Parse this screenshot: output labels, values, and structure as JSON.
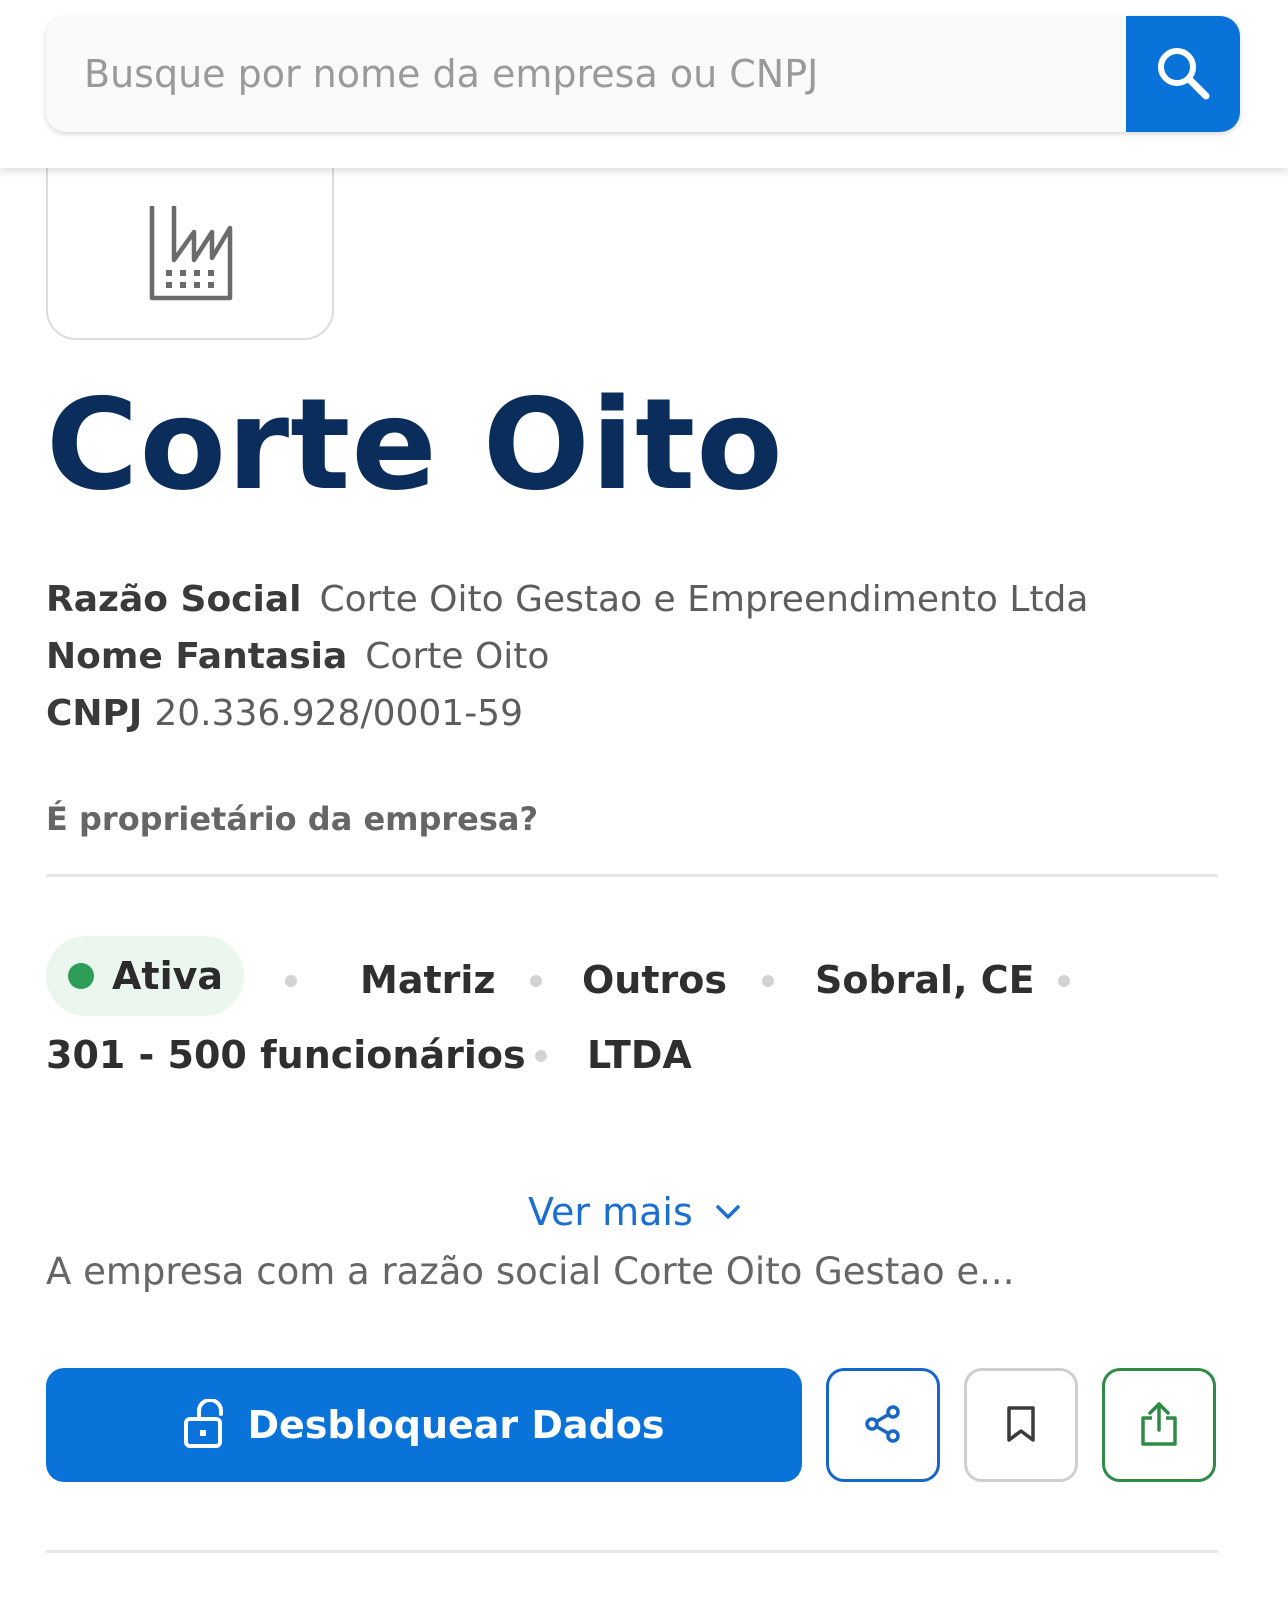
{
  "search": {
    "placeholder": "Busque por nome da empresa ou CNPJ"
  },
  "company": {
    "title": "Corte Oito",
    "razao_social_label": "Razão Social",
    "razao_social_value": "Corte Oito Gestao e Empreendimento Ltda",
    "nome_fantasia_label": "Nome Fantasia",
    "nome_fantasia_value": "Corte Oito",
    "cnpj_label": "CNPJ",
    "cnpj_value": "20.336.928/0001-59",
    "owner_question": "É proprietário da empresa?"
  },
  "tags": {
    "status": "Ativa",
    "type": "Matriz",
    "category": "Outros",
    "location": "Sobral, CE",
    "employees": "301 - 500 funcionários",
    "legal_form": "LTDA"
  },
  "details": {
    "ver_mais_label": "Ver mais",
    "description": "A empresa com a razão social Corte Oito Gestao e..."
  },
  "actions": {
    "unlock_label": "Desbloquear Dados"
  },
  "colors": {
    "primary": "#0a73d9",
    "title": "#0b2d5b",
    "status_green": "#2e9d57",
    "export_green": "#2e8b45"
  },
  "icons": {
    "search": "search-icon",
    "logo": "factory-icon",
    "chevron": "chevron-down-icon",
    "unlock": "unlock-icon",
    "share": "share-icon",
    "bookmark": "bookmark-icon",
    "export": "export-icon"
  }
}
